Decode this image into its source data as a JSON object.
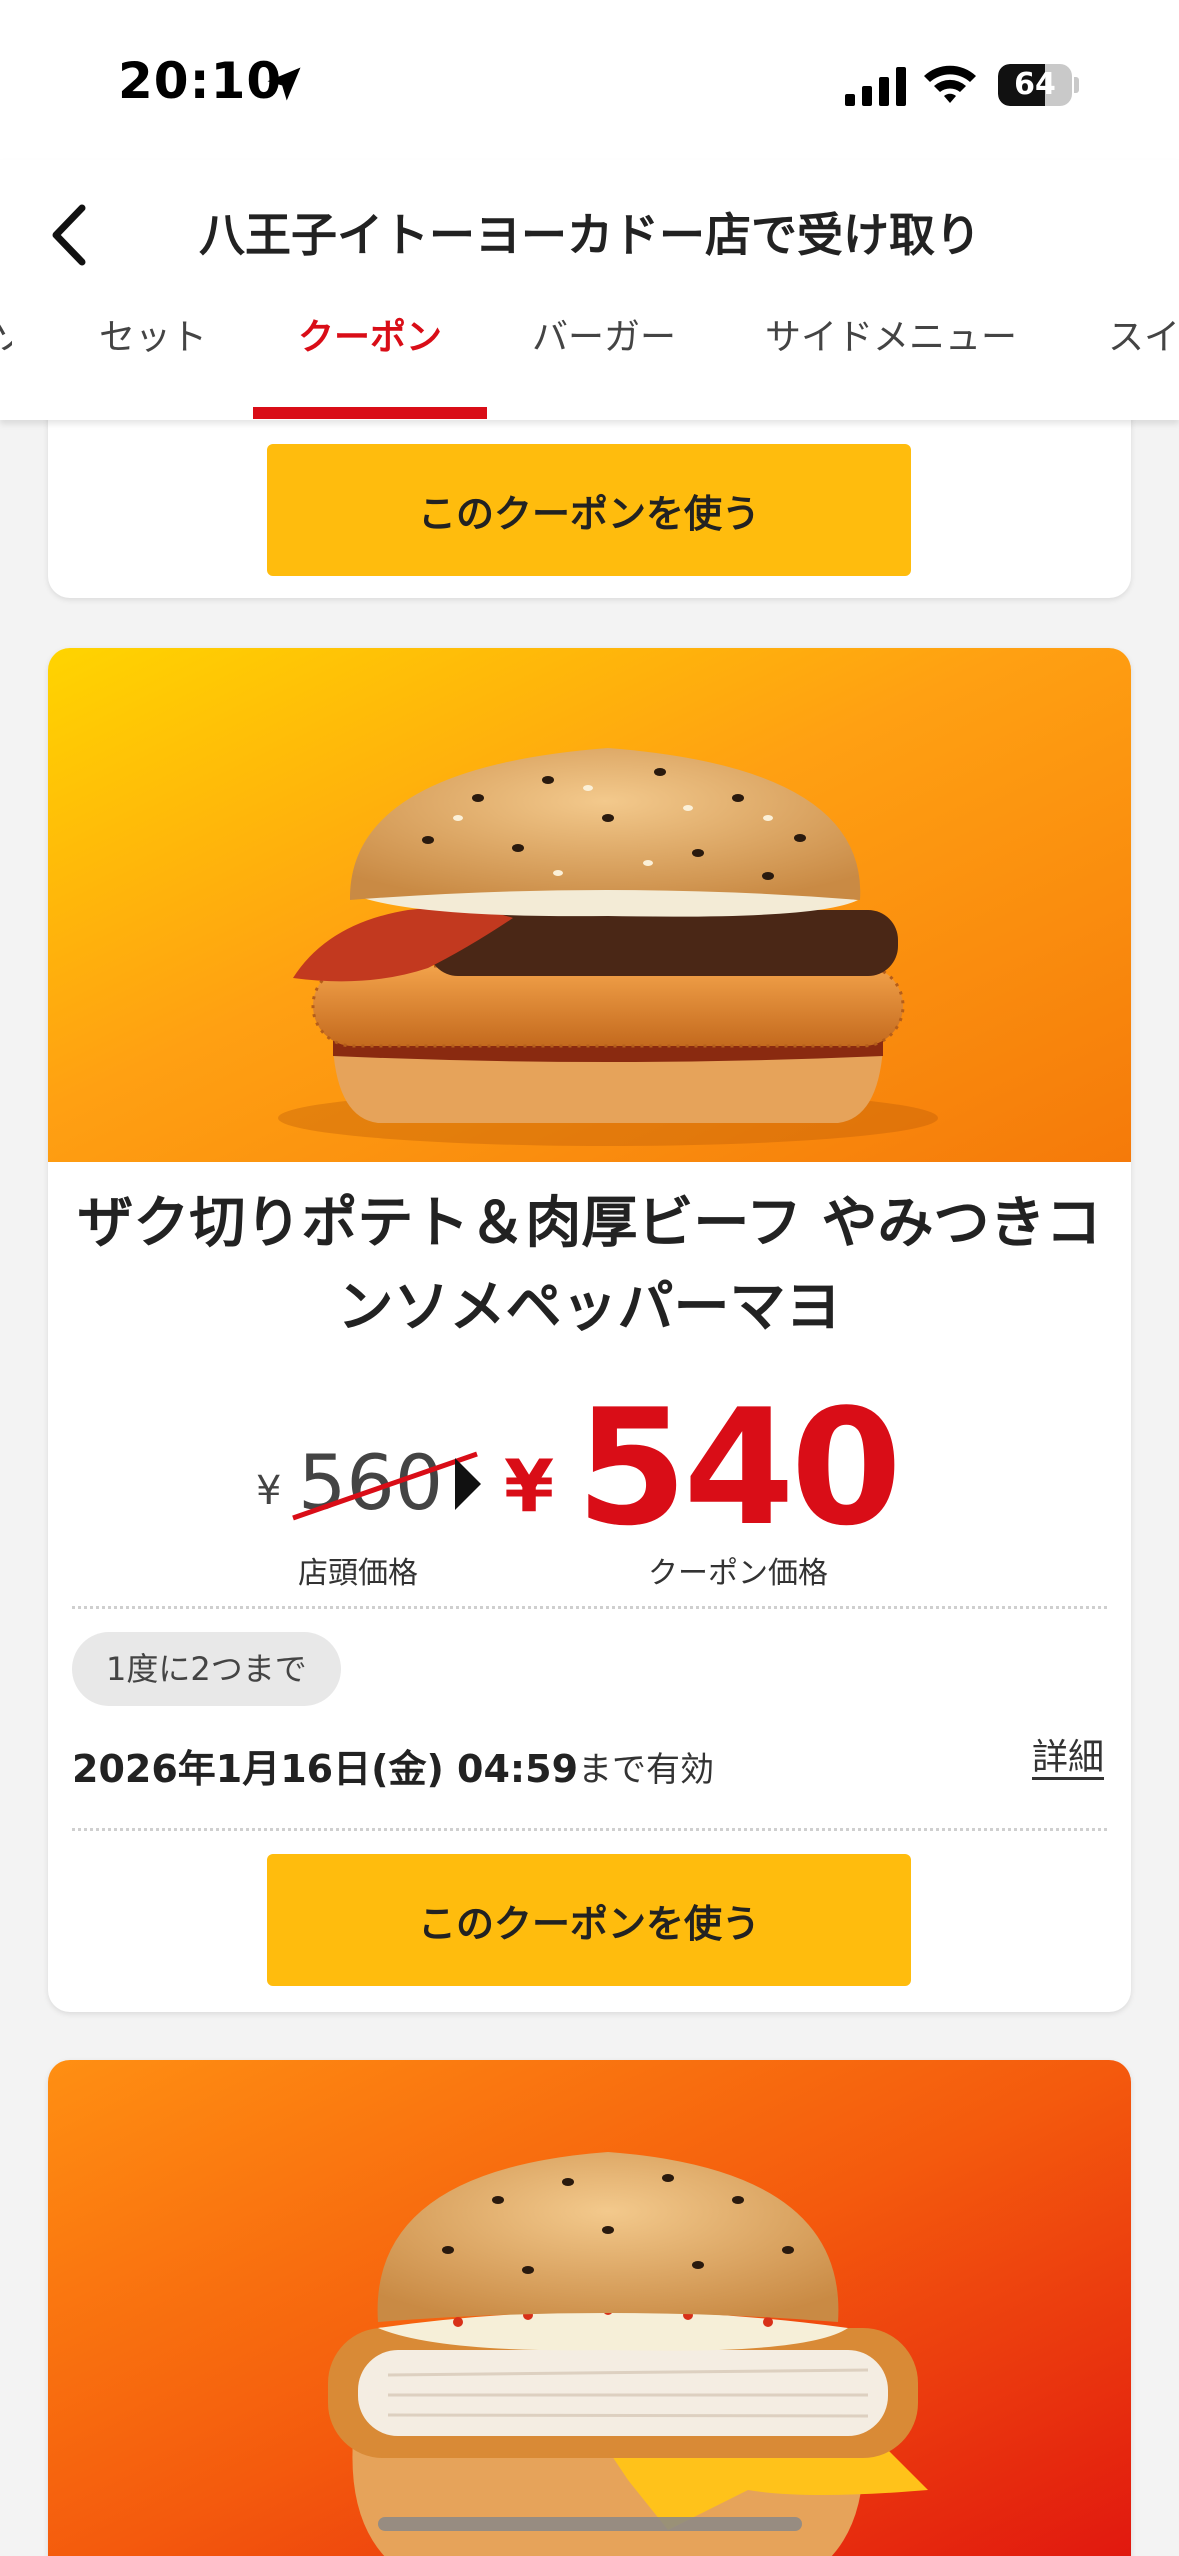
{
  "status_bar": {
    "time": "20:10",
    "battery": "64",
    "battery_level": 0.64
  },
  "header": {
    "title": "八王子イトーヨーカドー店で受け取り",
    "tabs": [
      {
        "label": "ソ"
      },
      {
        "label": "セット"
      },
      {
        "label": "クーポン"
      },
      {
        "label": "バーガー"
      },
      {
        "label": "サイドメニュー"
      },
      {
        "label": "スイ"
      }
    ],
    "active_tab": "クーポン"
  },
  "coupons": [
    {
      "button_label": "このクーポンを使う"
    },
    {
      "name": "ザク切りポテト＆肉厚ビーフ やみつきコンソメペッパーマヨ",
      "old_price_currency": "¥",
      "old_price": "560",
      "old_price_label": "店頭価格",
      "new_price_currency": "¥",
      "new_price": "540",
      "new_price_label": "クーポン価格",
      "limit": "1度に2つまで",
      "valid_until": "2026年1月16日(金) 04:59",
      "valid_suffix": "まで有効",
      "detail_label": "詳細",
      "button_label": "このクーポンを使う"
    },
    {}
  ],
  "colors": {
    "accent_red": "#d90d17",
    "button_yellow": "#ffbc0d"
  }
}
